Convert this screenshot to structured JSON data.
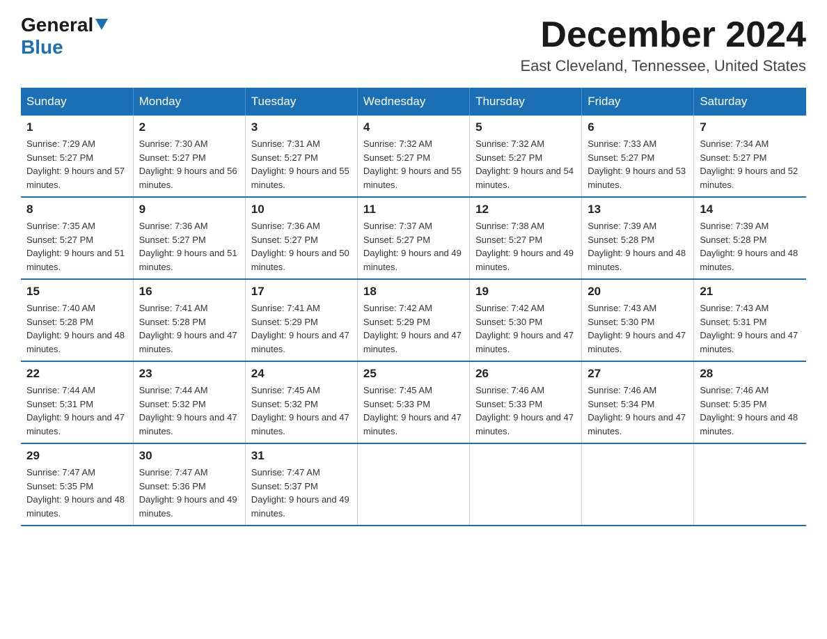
{
  "header": {
    "logo_general": "General",
    "logo_blue": "Blue",
    "month_title": "December 2024",
    "location": "East Cleveland, Tennessee, United States"
  },
  "days_of_week": [
    "Sunday",
    "Monday",
    "Tuesday",
    "Wednesday",
    "Thursday",
    "Friday",
    "Saturday"
  ],
  "weeks": [
    [
      {
        "num": "1",
        "sunrise": "7:29 AM",
        "sunset": "5:27 PM",
        "daylight": "9 hours and 57 minutes."
      },
      {
        "num": "2",
        "sunrise": "7:30 AM",
        "sunset": "5:27 PM",
        "daylight": "9 hours and 56 minutes."
      },
      {
        "num": "3",
        "sunrise": "7:31 AM",
        "sunset": "5:27 PM",
        "daylight": "9 hours and 55 minutes."
      },
      {
        "num": "4",
        "sunrise": "7:32 AM",
        "sunset": "5:27 PM",
        "daylight": "9 hours and 55 minutes."
      },
      {
        "num": "5",
        "sunrise": "7:32 AM",
        "sunset": "5:27 PM",
        "daylight": "9 hours and 54 minutes."
      },
      {
        "num": "6",
        "sunrise": "7:33 AM",
        "sunset": "5:27 PM",
        "daylight": "9 hours and 53 minutes."
      },
      {
        "num": "7",
        "sunrise": "7:34 AM",
        "sunset": "5:27 PM",
        "daylight": "9 hours and 52 minutes."
      }
    ],
    [
      {
        "num": "8",
        "sunrise": "7:35 AM",
        "sunset": "5:27 PM",
        "daylight": "9 hours and 51 minutes."
      },
      {
        "num": "9",
        "sunrise": "7:36 AM",
        "sunset": "5:27 PM",
        "daylight": "9 hours and 51 minutes."
      },
      {
        "num": "10",
        "sunrise": "7:36 AM",
        "sunset": "5:27 PM",
        "daylight": "9 hours and 50 minutes."
      },
      {
        "num": "11",
        "sunrise": "7:37 AM",
        "sunset": "5:27 PM",
        "daylight": "9 hours and 49 minutes."
      },
      {
        "num": "12",
        "sunrise": "7:38 AM",
        "sunset": "5:27 PM",
        "daylight": "9 hours and 49 minutes."
      },
      {
        "num": "13",
        "sunrise": "7:39 AM",
        "sunset": "5:28 PM",
        "daylight": "9 hours and 48 minutes."
      },
      {
        "num": "14",
        "sunrise": "7:39 AM",
        "sunset": "5:28 PM",
        "daylight": "9 hours and 48 minutes."
      }
    ],
    [
      {
        "num": "15",
        "sunrise": "7:40 AM",
        "sunset": "5:28 PM",
        "daylight": "9 hours and 48 minutes."
      },
      {
        "num": "16",
        "sunrise": "7:41 AM",
        "sunset": "5:28 PM",
        "daylight": "9 hours and 47 minutes."
      },
      {
        "num": "17",
        "sunrise": "7:41 AM",
        "sunset": "5:29 PM",
        "daylight": "9 hours and 47 minutes."
      },
      {
        "num": "18",
        "sunrise": "7:42 AM",
        "sunset": "5:29 PM",
        "daylight": "9 hours and 47 minutes."
      },
      {
        "num": "19",
        "sunrise": "7:42 AM",
        "sunset": "5:30 PM",
        "daylight": "9 hours and 47 minutes."
      },
      {
        "num": "20",
        "sunrise": "7:43 AM",
        "sunset": "5:30 PM",
        "daylight": "9 hours and 47 minutes."
      },
      {
        "num": "21",
        "sunrise": "7:43 AM",
        "sunset": "5:31 PM",
        "daylight": "9 hours and 47 minutes."
      }
    ],
    [
      {
        "num": "22",
        "sunrise": "7:44 AM",
        "sunset": "5:31 PM",
        "daylight": "9 hours and 47 minutes."
      },
      {
        "num": "23",
        "sunrise": "7:44 AM",
        "sunset": "5:32 PM",
        "daylight": "9 hours and 47 minutes."
      },
      {
        "num": "24",
        "sunrise": "7:45 AM",
        "sunset": "5:32 PM",
        "daylight": "9 hours and 47 minutes."
      },
      {
        "num": "25",
        "sunrise": "7:45 AM",
        "sunset": "5:33 PM",
        "daylight": "9 hours and 47 minutes."
      },
      {
        "num": "26",
        "sunrise": "7:46 AM",
        "sunset": "5:33 PM",
        "daylight": "9 hours and 47 minutes."
      },
      {
        "num": "27",
        "sunrise": "7:46 AM",
        "sunset": "5:34 PM",
        "daylight": "9 hours and 47 minutes."
      },
      {
        "num": "28",
        "sunrise": "7:46 AM",
        "sunset": "5:35 PM",
        "daylight": "9 hours and 48 minutes."
      }
    ],
    [
      {
        "num": "29",
        "sunrise": "7:47 AM",
        "sunset": "5:35 PM",
        "daylight": "9 hours and 48 minutes."
      },
      {
        "num": "30",
        "sunrise": "7:47 AM",
        "sunset": "5:36 PM",
        "daylight": "9 hours and 49 minutes."
      },
      {
        "num": "31",
        "sunrise": "7:47 AM",
        "sunset": "5:37 PM",
        "daylight": "9 hours and 49 minutes."
      },
      null,
      null,
      null,
      null
    ]
  ]
}
